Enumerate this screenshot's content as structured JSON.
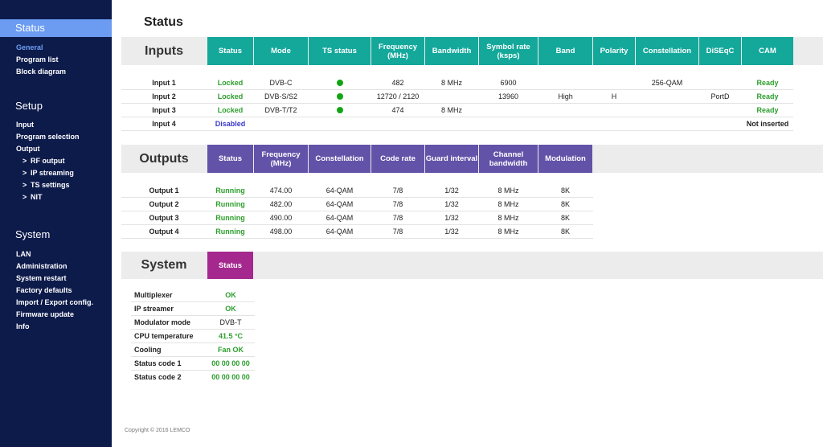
{
  "sidebar": {
    "sections": [
      {
        "title": "Status",
        "items": [
          {
            "label": "General"
          },
          {
            "label": "Program list"
          },
          {
            "label": "Block diagram"
          }
        ]
      },
      {
        "title": "Setup",
        "items": [
          {
            "label": "Input"
          },
          {
            "label": "Program selection"
          },
          {
            "label": "Output"
          }
        ],
        "subitems": [
          {
            "label": "RF output"
          },
          {
            "label": "IP streaming"
          },
          {
            "label": "TS settings"
          },
          {
            "label": "NIT"
          }
        ]
      },
      {
        "title": "System",
        "items": [
          {
            "label": "LAN"
          },
          {
            "label": "Administration"
          },
          {
            "label": "System restart"
          },
          {
            "label": "Factory defaults"
          },
          {
            "label": "Import / Export config."
          },
          {
            "label": "Firmware update"
          },
          {
            "label": "Info"
          }
        ]
      }
    ],
    "chevron": ">"
  },
  "page": {
    "title": "Status",
    "copyright": "Copyright © 2016 LEMCO"
  },
  "inputs": {
    "title": "Inputs",
    "headers": [
      "Status",
      "Mode",
      "TS status",
      "Frequency (MHz)",
      "Bandwidth",
      "Symbol rate (ksps)",
      "Band",
      "Polarity",
      "Constellation",
      "DiSEqC",
      "CAM"
    ],
    "rows": [
      {
        "name": "Input 1",
        "status": "Locked",
        "mode": "DVB-C",
        "ts": "dot",
        "freq": "482",
        "bw": "8 MHz",
        "sr": "6900",
        "band": "",
        "pol": "",
        "const": "256-QAM",
        "diseqc": "",
        "cam": "Ready"
      },
      {
        "name": "Input 2",
        "status": "Locked",
        "mode": "DVB-S/S2",
        "ts": "dot",
        "freq": "12720 / 2120",
        "bw": "",
        "sr": "13960",
        "band": "High",
        "pol": "H",
        "const": "",
        "diseqc": "PortD",
        "cam": "Ready"
      },
      {
        "name": "Input 3",
        "status": "Locked",
        "mode": "DVB-T/T2",
        "ts": "dot",
        "freq": "474",
        "bw": "8 MHz",
        "sr": "",
        "band": "",
        "pol": "",
        "const": "",
        "diseqc": "",
        "cam": "Ready"
      },
      {
        "name": "Input 4",
        "status": "Disabled",
        "mode": "",
        "ts": "",
        "freq": "",
        "bw": "",
        "sr": "",
        "band": "",
        "pol": "",
        "const": "",
        "diseqc": "",
        "cam": "Not inserted"
      }
    ]
  },
  "outputs": {
    "title": "Outputs",
    "headers": [
      "Status",
      "Frequency (MHz)",
      "Constellation",
      "Code rate",
      "Guard interval",
      "Channel bandwidth",
      "Modulation"
    ],
    "rows": [
      {
        "name": "Output 1",
        "status": "Running",
        "freq": "474.00",
        "const": "64-QAM",
        "cr": "7/8",
        "gi": "1/32",
        "cbw": "8 MHz",
        "mod": "8K"
      },
      {
        "name": "Output 2",
        "status": "Running",
        "freq": "482.00",
        "const": "64-QAM",
        "cr": "7/8",
        "gi": "1/32",
        "cbw": "8 MHz",
        "mod": "8K"
      },
      {
        "name": "Output 3",
        "status": "Running",
        "freq": "490.00",
        "const": "64-QAM",
        "cr": "7/8",
        "gi": "1/32",
        "cbw": "8 MHz",
        "mod": "8K"
      },
      {
        "name": "Output 4",
        "status": "Running",
        "freq": "498.00",
        "const": "64-QAM",
        "cr": "7/8",
        "gi": "1/32",
        "cbw": "8 MHz",
        "mod": "8K"
      }
    ]
  },
  "system": {
    "title": "System",
    "header": "Status",
    "rows": [
      {
        "label": "Multiplexer",
        "value": "OK",
        "style": "green"
      },
      {
        "label": "IP streamer",
        "value": "OK",
        "style": "green"
      },
      {
        "label": "Modulator mode",
        "value": "DVB-T",
        "style": "plain"
      },
      {
        "label": "CPU temperature",
        "value": "41.5 °C",
        "style": "green"
      },
      {
        "label": "Cooling",
        "value": "Fan OK",
        "style": "green"
      },
      {
        "label": "Status code 1",
        "value": "00 00 00 00",
        "style": "green"
      },
      {
        "label": "Status code 2",
        "value": "00 00 00 00",
        "style": "green"
      }
    ]
  },
  "colors": {
    "sidebar_bg": "#0d1b4b",
    "active_section": "#6b9cf2",
    "inputs_header": "#14a89b",
    "outputs_header": "#6253a8",
    "system_header": "#a4288e",
    "ok_green": "#2c9e2c",
    "disabled_blue": "#3a38c8",
    "ts_dot": "#12a512"
  }
}
